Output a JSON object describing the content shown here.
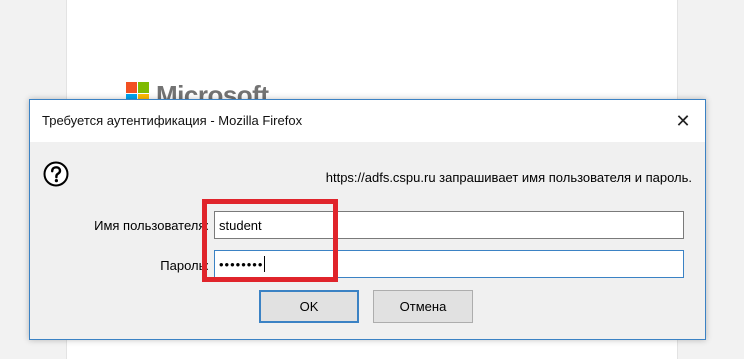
{
  "background": {
    "brand": "Microsoft",
    "logo_colors": [
      "#f25022",
      "#7fba00",
      "#00a4ef",
      "#ffb900"
    ]
  },
  "dialog": {
    "title": "Требуется аутентификация - Mozilla Firefox",
    "close_label": "✕",
    "icon": "question-icon",
    "message": "https://adfs.cspu.ru запрашивает имя пользователя и пароль.",
    "username_label": "Имя пользователя:",
    "username_value": "student",
    "password_label": "Пароль:",
    "password_value": "••••••••",
    "ok_label": "OK",
    "cancel_label": "Отмена"
  },
  "colors": {
    "focus_border": "#3b82c4",
    "highlight_box": "#e0242b"
  }
}
